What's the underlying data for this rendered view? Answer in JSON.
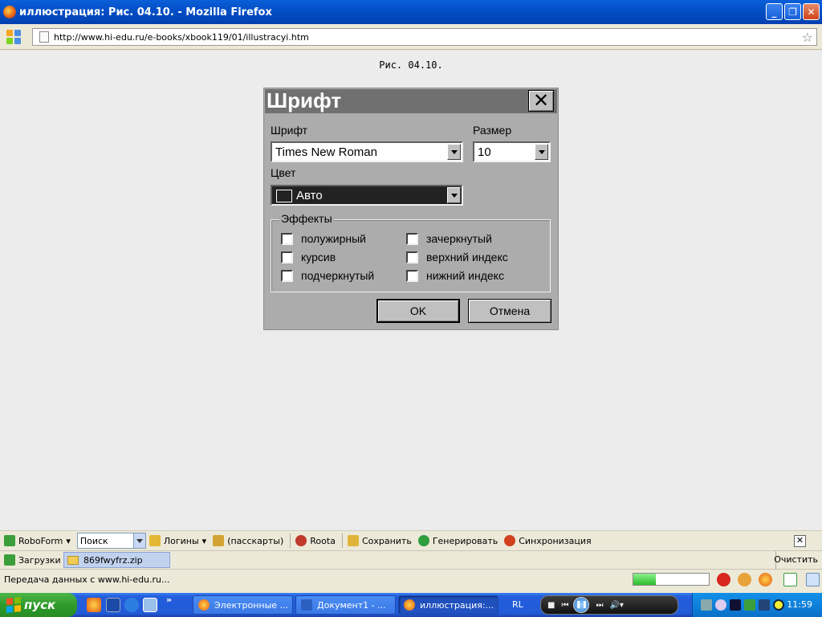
{
  "window": {
    "title": "иллюстрация: Рис. 04.10. - Mozilla Firefox",
    "min_label": "_",
    "max_label": "❐",
    "close_label": "✕"
  },
  "nav": {
    "url": "http://www.hi-edu.ru/e-books/xbook119/01/illustracyi.htm"
  },
  "page": {
    "caption": "Рис. 04.10."
  },
  "dialog": {
    "title": "Шрифт",
    "close_glyph": "✕",
    "font_label": "Шрифт",
    "font_value": "Times New Roman",
    "size_label": "Размер",
    "size_value": "10",
    "color_label": "Цвет",
    "color_value": "Авто",
    "effects_label": "Эффекты",
    "effects": [
      {
        "label": "полужирный",
        "checked": false
      },
      {
        "label": "курсив",
        "checked": false
      },
      {
        "label": "подчеркнутый",
        "checked": false
      },
      {
        "label": "зачеркнутый",
        "checked": false
      },
      {
        "label": "верхний индекс",
        "checked": false
      },
      {
        "label": "нижний индекс",
        "checked": false
      }
    ],
    "ok_label": "OK",
    "cancel_label": "Отмена"
  },
  "robobar": {
    "roboform": "RoboForm",
    "search_placeholder": "Поиск",
    "logins": "Логины",
    "passcards": "(пасскарты)",
    "roota": "Roota",
    "save": "Сохранить",
    "generate": "Генерировать",
    "sync": "Синхронизация",
    "close_glyph": "✕"
  },
  "downloads": {
    "label": "Загрузки",
    "item": "869fwyfrz.zip",
    "clear": "Очистить"
  },
  "status": {
    "text": "Передача данных с www.hi-edu.ru...",
    "progress_fraction": 0.3
  },
  "taskbar": {
    "start": "пуск",
    "more": "»",
    "tasks": [
      {
        "label": "Электронные ..."
      },
      {
        "label": "Документ1 - ..."
      },
      {
        "label": "иллюстрация:..."
      }
    ],
    "lang": "RL",
    "clock": "11:59"
  },
  "colors": {
    "titlebar": "#0a5fd8",
    "dialog_bg": "#acacac",
    "dialog_title": "#707070",
    "start_green": "#2f9a2b"
  }
}
